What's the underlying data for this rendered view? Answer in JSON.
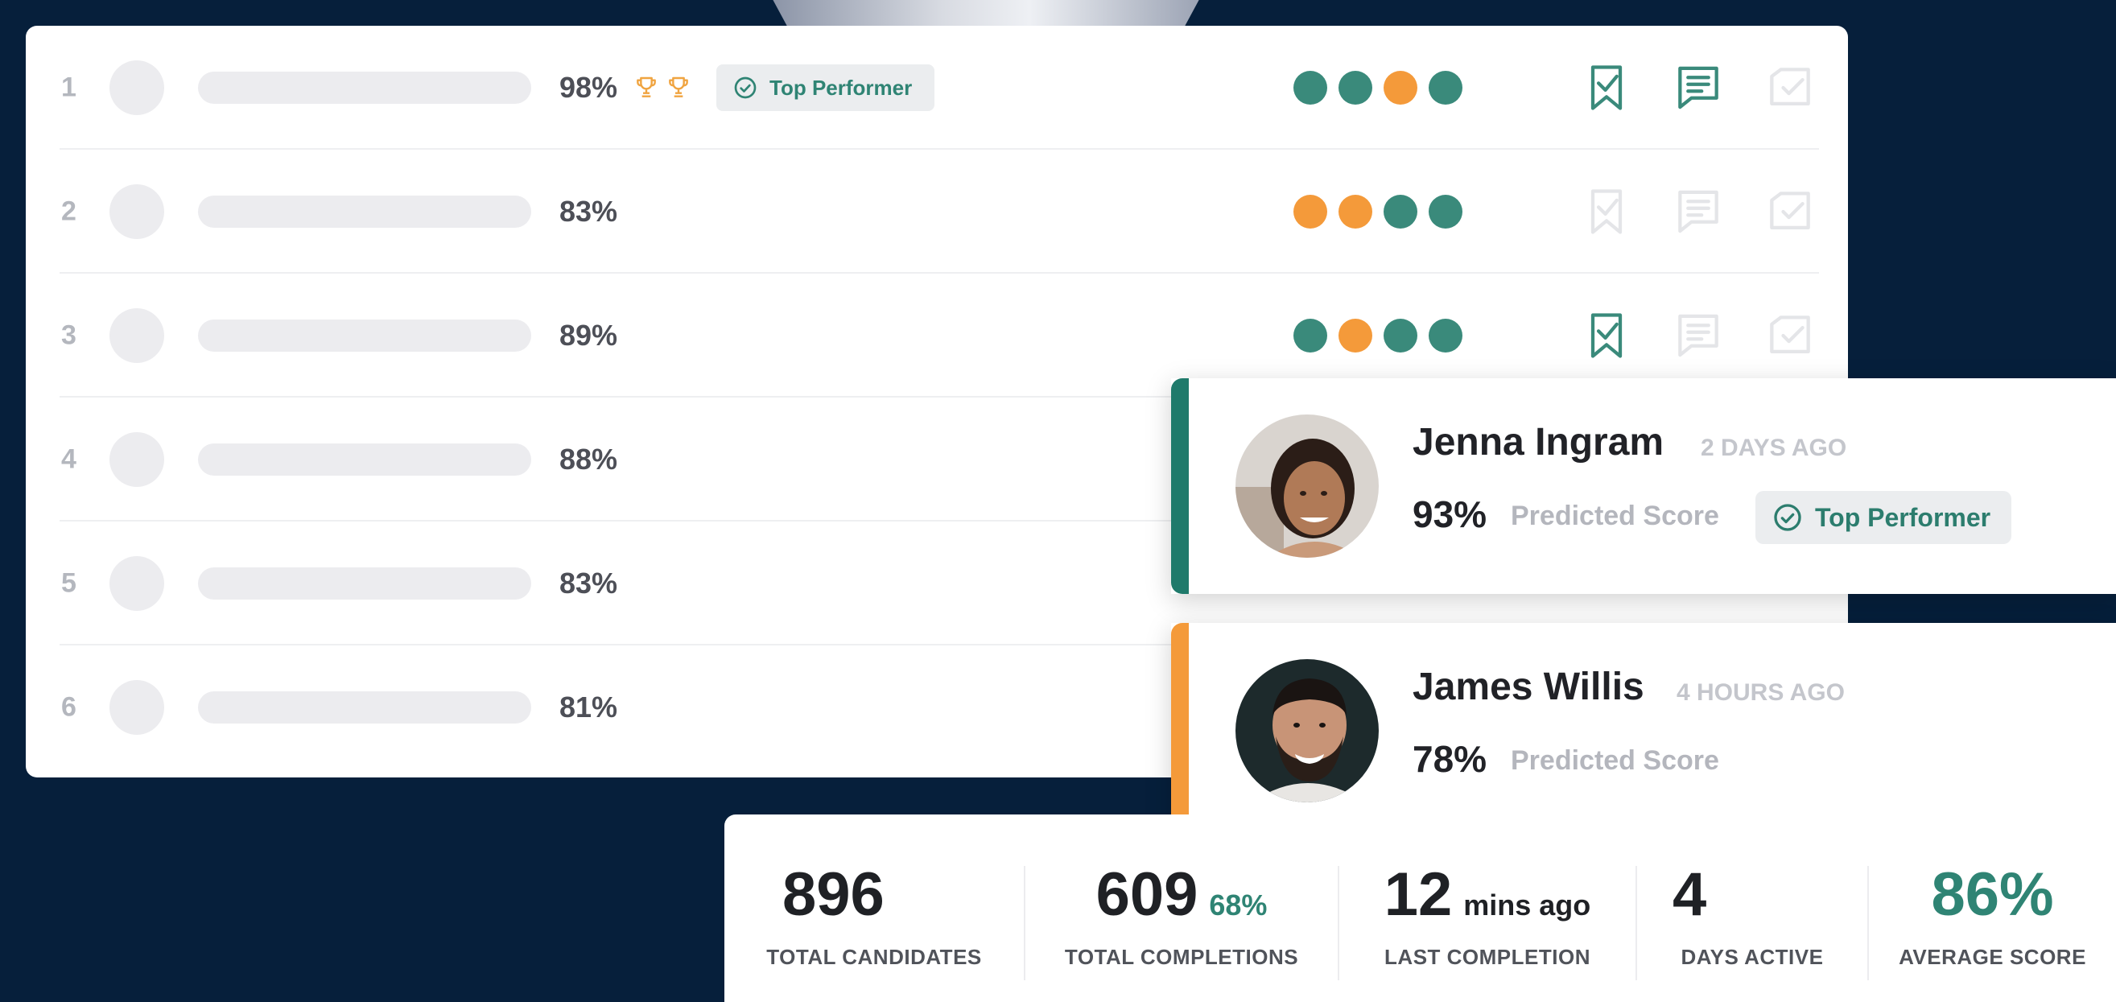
{
  "colors": {
    "teal": "#3a8a7b",
    "orange": "#f49a3a",
    "navy": "#061f3b"
  },
  "table": {
    "rows": [
      {
        "rank": "1",
        "score": "98%",
        "trophies": 2,
        "badge": "Top Performer",
        "dots": [
          "teal",
          "teal",
          "orange",
          "teal"
        ],
        "actions_active": [
          true,
          true,
          false
        ]
      },
      {
        "rank": "2",
        "score": "83%",
        "trophies": 0,
        "badge": "",
        "dots": [
          "orange",
          "orange",
          "teal",
          "teal"
        ],
        "actions_active": [
          false,
          false,
          false
        ]
      },
      {
        "rank": "3",
        "score": "89%",
        "trophies": 0,
        "badge": "",
        "dots": [
          "teal",
          "orange",
          "teal",
          "teal"
        ],
        "actions_active": [
          true,
          false,
          false
        ]
      },
      {
        "rank": "4",
        "score": "88%",
        "trophies": 0,
        "badge": "",
        "dots": [],
        "actions_active": []
      },
      {
        "rank": "5",
        "score": "83%",
        "trophies": 0,
        "badge": "",
        "dots": [],
        "actions_active": []
      },
      {
        "rank": "6",
        "score": "81%",
        "trophies": 0,
        "badge": "",
        "dots": [],
        "actions_active": []
      }
    ]
  },
  "profiles": [
    {
      "name": "Jenna Ingram",
      "time": "2 DAYS AGO",
      "score": "93%",
      "score_label": "Predicted Score",
      "badge": "Top Performer",
      "accent": "teal"
    },
    {
      "name": "James Willis",
      "time": "4 HOURS AGO",
      "score": "78%",
      "score_label": "Predicted Score",
      "badge": "",
      "accent": "orange"
    }
  ],
  "stats": [
    {
      "value": "896",
      "suffix": "",
      "label": "TOTAL CANDIDATES"
    },
    {
      "value": "609",
      "suffix": "68%",
      "label": "TOTAL COMPLETIONS"
    },
    {
      "value": "12",
      "suffix": "mins ago",
      "label": "LAST COMPLETION"
    },
    {
      "value": "4",
      "suffix": "",
      "label": "DAYS ACTIVE"
    },
    {
      "value": "86%",
      "suffix": "",
      "label": "AVERAGE SCORE"
    }
  ]
}
